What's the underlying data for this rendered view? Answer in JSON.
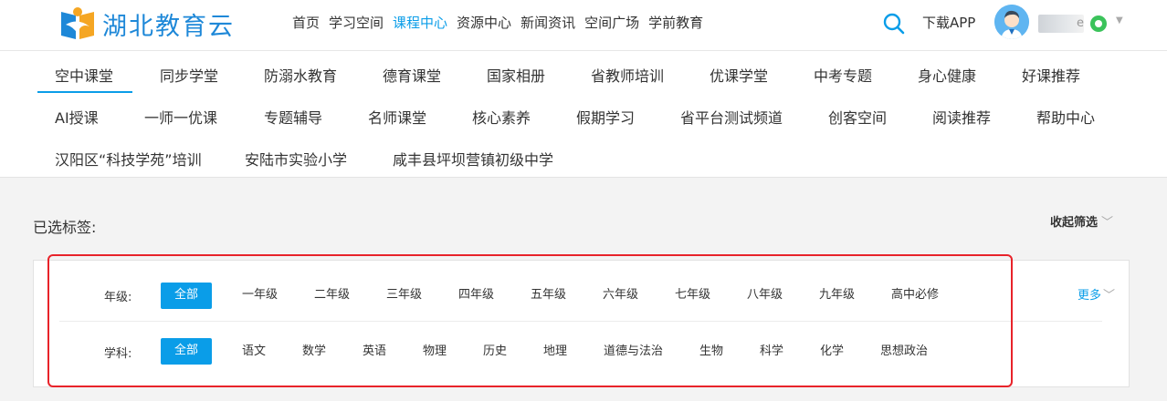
{
  "brand": {
    "name": "湖北教育云"
  },
  "nav": {
    "items": [
      "首页",
      "学习空间",
      "课程中心",
      "资源中心",
      "新闻资讯",
      "空间广场",
      "学前教育"
    ],
    "active_index": 2,
    "download": "下载APP",
    "username_tail": "e"
  },
  "categories": {
    "row1": [
      "空中课堂",
      "同步学堂",
      "防溺水教育",
      "德育课堂",
      "国家相册",
      "省教师培训",
      "优课学堂",
      "中考专题",
      "身心健康",
      "好课推荐"
    ],
    "row2": [
      "AI授课",
      "一师一优课",
      "专题辅导",
      "名师课堂",
      "核心素养",
      "假期学习",
      "省平台测试频道",
      "创客空间",
      "阅读推荐",
      "帮助中心"
    ],
    "row3": [
      "汉阳区“科技学苑”培训",
      "安陆市实验小学",
      "咸丰县坪坝营镇初级中学"
    ],
    "active": "空中课堂"
  },
  "filters": {
    "selected_label": "已选标签:",
    "collapse_label": "收起筛选",
    "more_label": "更多",
    "grade": {
      "label": "年级:",
      "options": [
        "全部",
        "一年级",
        "二年级",
        "三年级",
        "四年级",
        "五年级",
        "六年级",
        "七年级",
        "八年级",
        "九年级",
        "高中必修"
      ],
      "selected": "全部"
    },
    "subject": {
      "label": "学科:",
      "options": [
        "全部",
        "语文",
        "数学",
        "英语",
        "物理",
        "历史",
        "地理",
        "道德与法治",
        "生物",
        "科学",
        "化学",
        "思想政治"
      ],
      "selected": "全部"
    }
  },
  "colors": {
    "accent": "#0a9de8",
    "highlight": "#e8232a",
    "brand": "#1e88d8"
  }
}
